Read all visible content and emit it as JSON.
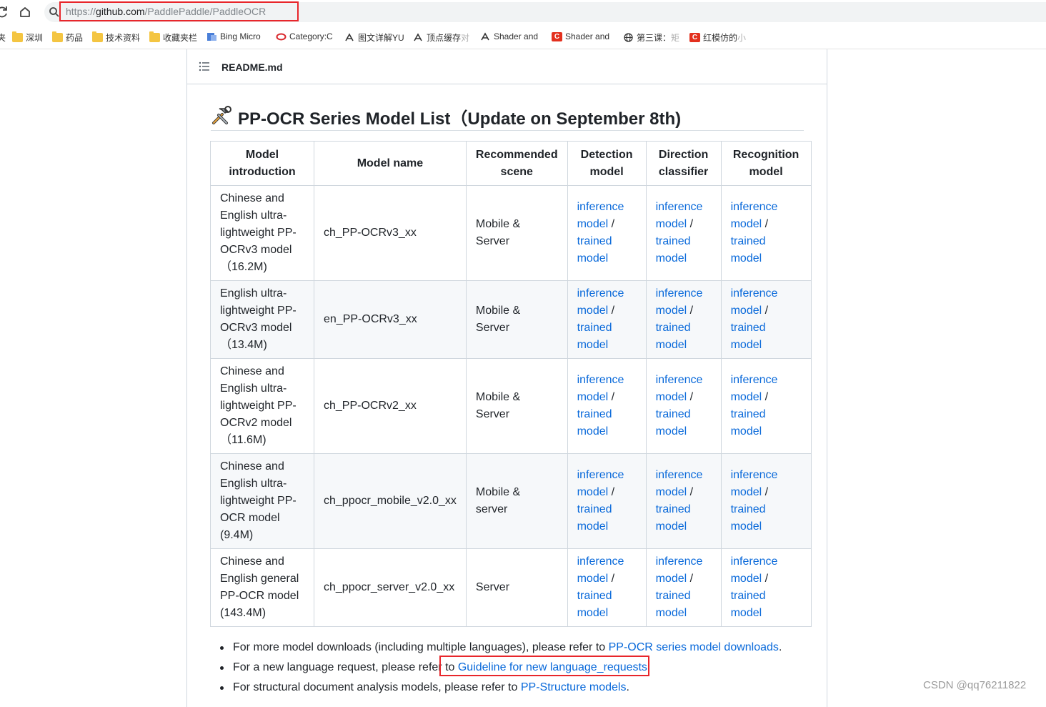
{
  "browser": {
    "url_prefix": "https://",
    "url_host": "github.com",
    "url_path": "/PaddlePaddle/PaddleOCR",
    "bookmarks": [
      {
        "label": "夹",
        "icon": "folder-icon"
      },
      {
        "label": "深圳",
        "icon": "folder-icon"
      },
      {
        "label": "药品",
        "icon": "folder-icon"
      },
      {
        "label": "技术资料",
        "icon": "folder-icon"
      },
      {
        "label": "收藏夹栏",
        "icon": "folder-icon"
      },
      {
        "label": "Bing Micro",
        "icon": "bing-icon"
      },
      {
        "label": "Category:C",
        "icon": "ring-icon"
      },
      {
        "label": "图文详解YU",
        "icon": "yuque-icon"
      },
      {
        "label": "顶点缓存对",
        "icon": "yuque-icon"
      },
      {
        "label": "Shader and",
        "icon": "yuque-icon"
      },
      {
        "label": "Shader and",
        "icon": "csdn-icon"
      },
      {
        "label": "第三课：矩",
        "icon": "globe-icon"
      },
      {
        "label": "红模仿的小",
        "icon": "csdn-icon"
      }
    ]
  },
  "readme": {
    "filename": "README.md",
    "heading": "PP-OCR Series Model List（Update on September 8th)",
    "table": {
      "headers": [
        [
          "Model",
          "introduction"
        ],
        [
          "Model name"
        ],
        [
          "Recommended",
          "scene"
        ],
        [
          "Detection",
          "model"
        ],
        [
          "Direction",
          "classifier"
        ],
        [
          "Recognition",
          "model"
        ]
      ],
      "link_lines": [
        {
          "text": "inference",
          "suffix": ""
        },
        {
          "text": "model",
          "suffix": " /"
        },
        {
          "text": "trained",
          "suffix": ""
        },
        {
          "text": "model",
          "suffix": ""
        }
      ],
      "rows": [
        {
          "intro": [
            "Chinese and",
            "English ultra-",
            "lightweight PP-",
            "OCRv3 model",
            "（16.2M)"
          ],
          "name": "ch_PP-OCRv3_xx",
          "scene": [
            "Mobile &",
            "Server"
          ]
        },
        {
          "intro": [
            "English ultra-",
            "lightweight PP-",
            "OCRv3 model",
            "（13.4M)"
          ],
          "name": "en_PP-OCRv3_xx",
          "scene": [
            "Mobile &",
            "Server"
          ]
        },
        {
          "intro": [
            "Chinese and",
            "English ultra-",
            "lightweight PP-",
            "OCRv2 model",
            "（11.6M)"
          ],
          "name": "ch_PP-OCRv2_xx",
          "scene": [
            "Mobile &",
            "Server"
          ]
        },
        {
          "intro": [
            "Chinese and",
            "English ultra-",
            "lightweight PP-",
            "OCR model",
            "(9.4M)"
          ],
          "name": "ch_ppocr_mobile_v2.0_xx",
          "scene": [
            "Mobile &",
            "server"
          ]
        },
        {
          "intro": [
            "Chinese and",
            "English general",
            "PP-OCR model",
            "(143.4M)"
          ],
          "name": "ch_ppocr_server_v2.0_xx",
          "scene": [
            "Server"
          ]
        }
      ]
    },
    "notes": [
      {
        "before": "For more model downloads (including multiple languages), please refer to ",
        "link": "PP-OCR series model downloads",
        "after": "."
      },
      {
        "before": "For a new language request, please refer to ",
        "link": "Guideline for new language_requests",
        "after": "."
      },
      {
        "before": "For structural document analysis models, please refer to ",
        "link": "PP-Structure models",
        "after": "."
      }
    ]
  },
  "watermark": "CSDN @qq76211822",
  "colors": {
    "link": "#0969da",
    "highlight": "#e8262b",
    "border": "#d0d7de",
    "row_alt": "#f6f8fa"
  }
}
